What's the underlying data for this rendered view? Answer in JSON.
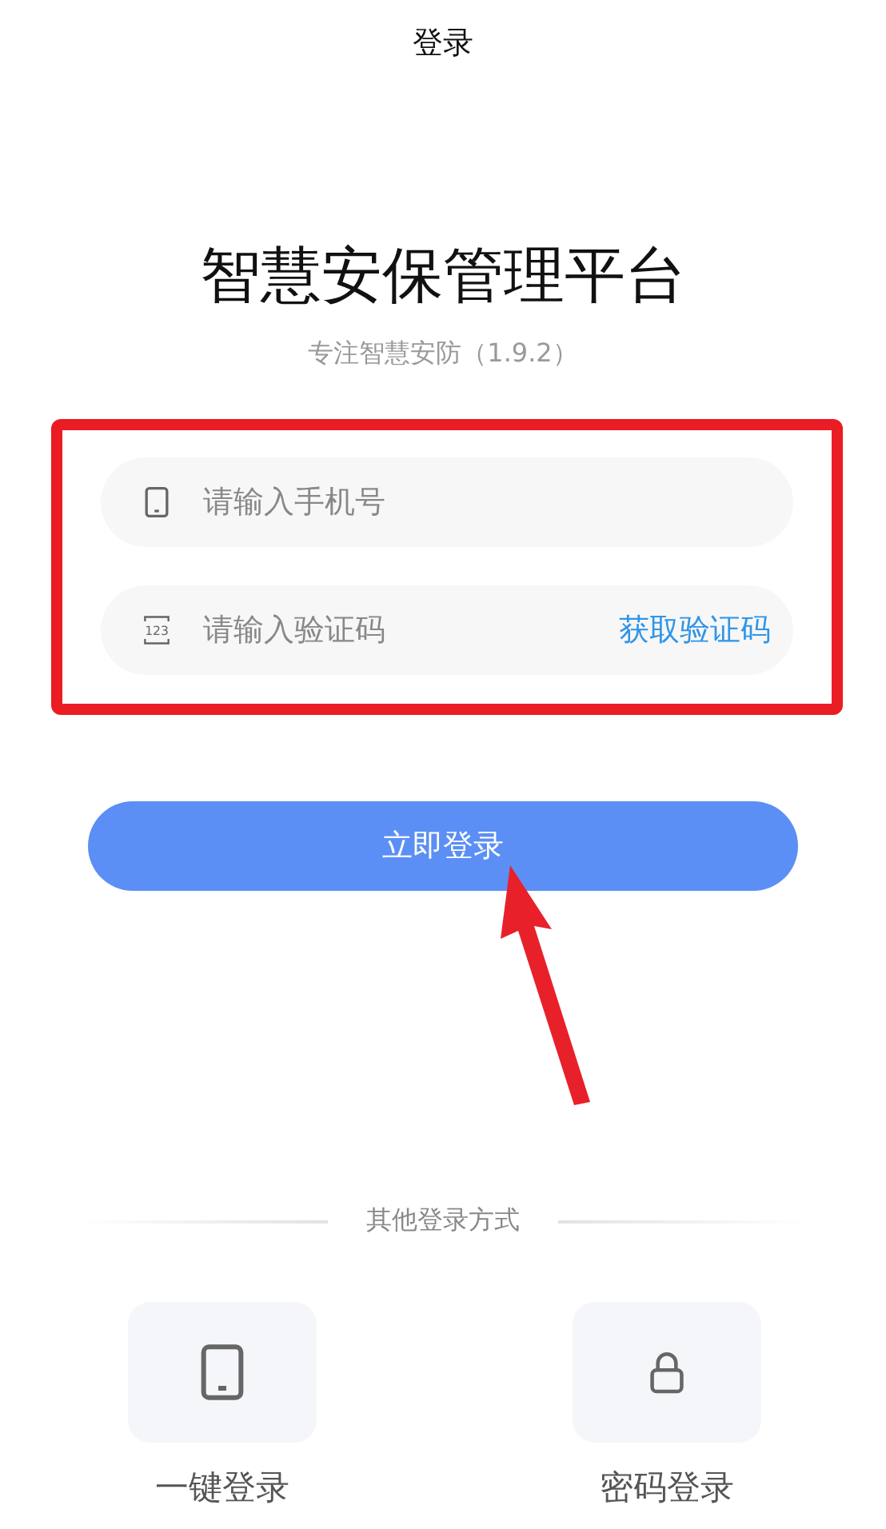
{
  "header": {
    "title": "登录"
  },
  "app": {
    "name": "智慧安保管理平台",
    "subtitle": "专注智慧安防（1.9.2）"
  },
  "form": {
    "highlighted": true,
    "fields": [
      {
        "kind": "phone",
        "placeholder": "请输入手机号"
      },
      {
        "kind": "code",
        "icon_text": "123",
        "placeholder": "请输入验证码",
        "action": "获取验证码"
      }
    ]
  },
  "login_button": {
    "label": "立即登录"
  },
  "pointer_arrow": true,
  "other_logins": {
    "title": "其他登录方式",
    "options": [
      {
        "kind": "phone",
        "label": "一键登录"
      },
      {
        "kind": "password",
        "label": "密码登录"
      }
    ]
  }
}
